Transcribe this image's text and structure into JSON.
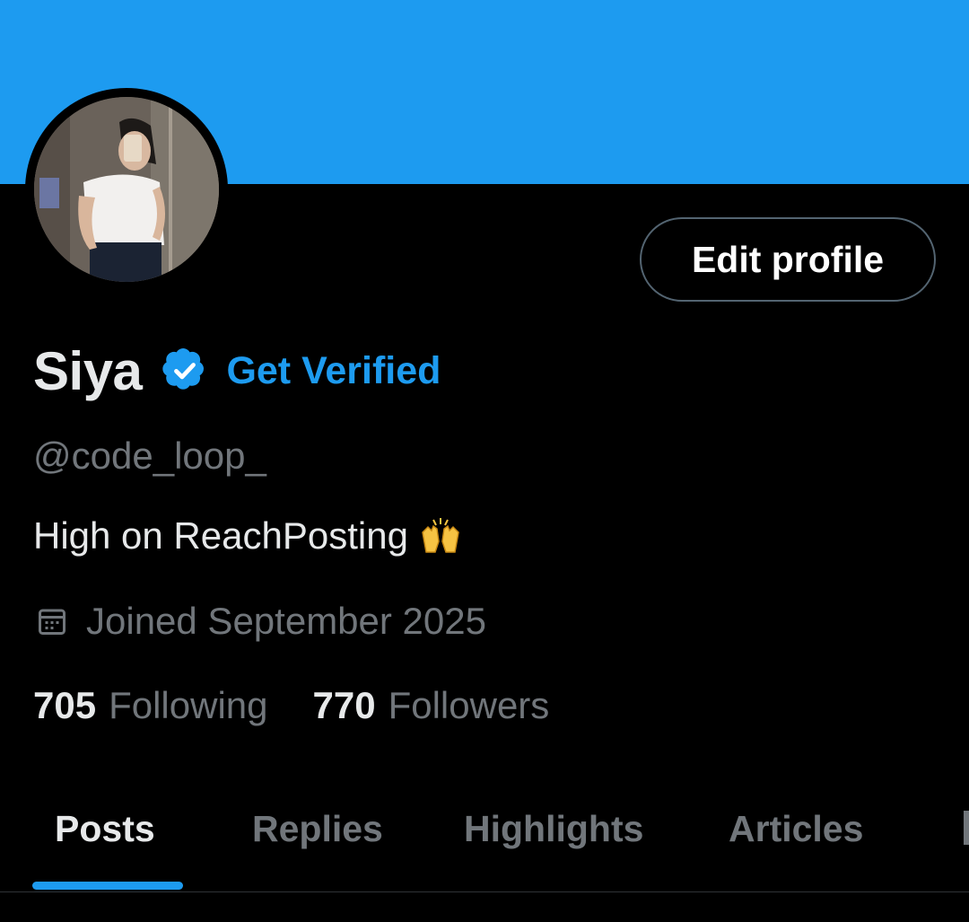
{
  "profile": {
    "name": "Siya",
    "get_verified_label": "Get Verified",
    "handle": "@code_loop_",
    "bio": "High on ReachPosting",
    "bio_emoji": "raised-hands-icon",
    "joined": "Joined September 2025",
    "edit_profile_label": "Edit profile"
  },
  "stats": {
    "following_count": "705",
    "following_label": "Following",
    "followers_count": "770",
    "followers_label": "Followers"
  },
  "tabs": [
    {
      "label": "Posts",
      "active": true
    },
    {
      "label": "Replies",
      "active": false
    },
    {
      "label": "Highlights",
      "active": false
    },
    {
      "label": "Articles",
      "active": false
    }
  ],
  "colors": {
    "accent": "#1d9bf0",
    "background": "#000000",
    "text_primary": "#e7e9ea",
    "text_secondary": "#71767b"
  },
  "icons": {
    "verified": "verified-badge-icon",
    "calendar": "calendar-icon"
  }
}
